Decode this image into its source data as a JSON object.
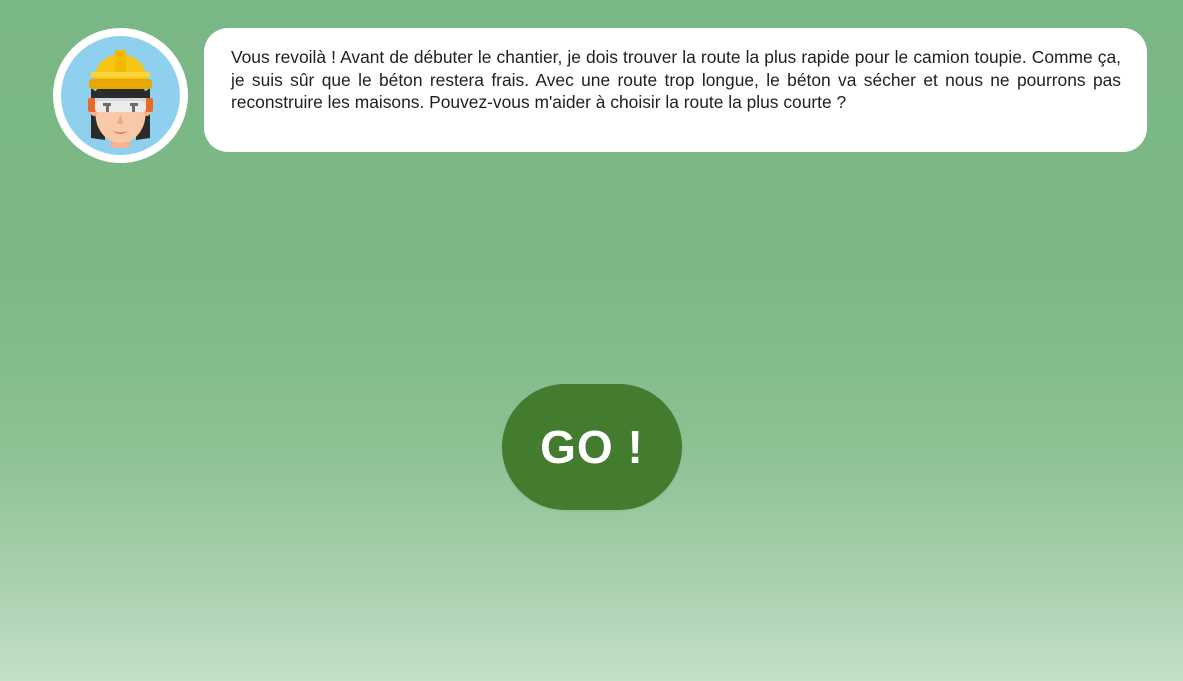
{
  "speech": {
    "text": "Vous revoilà ! Avant de débuter le chantier, je dois trouver la route la plus rapide pour le camion toupie. Comme ça, je suis sûr que le béton restera frais. Avec une route trop longue, le béton va sécher et nous ne pourrons pas reconstruire les maisons. Pouvez-vous m'aider à choisir la route la plus courte ?"
  },
  "actions": {
    "go_label": "GO !"
  },
  "avatar": {
    "icon": "construction-worker-icon"
  },
  "colors": {
    "background_top": "#79b785",
    "background_bottom": "#c4e0c7",
    "bubble": "#ffffff",
    "go_button": "#437b2f",
    "avatar_bg": "#8fd0ef",
    "helmet": "#f5c518"
  }
}
